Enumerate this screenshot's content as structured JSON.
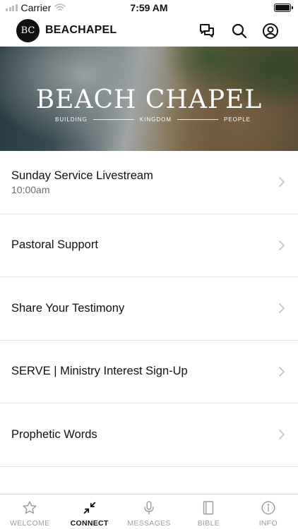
{
  "status_bar": {
    "carrier": "Carrier",
    "time": "7:59 AM"
  },
  "header": {
    "logo_text": "BC",
    "title": "BEACHAPEL"
  },
  "banner": {
    "title": "BEACH CHAPEL",
    "tagline": [
      "BUILDING",
      "KINGDOM",
      "PEOPLE"
    ]
  },
  "menu": [
    {
      "label": "Sunday Service Livestream",
      "sublabel": "10:00am"
    },
    {
      "label": "Pastoral Support"
    },
    {
      "label": "Share Your Testimony"
    },
    {
      "label": "SERVE | Ministry Interest Sign-Up"
    },
    {
      "label": "Prophetic Words"
    }
  ],
  "tabs": [
    {
      "label": "WELCOME",
      "icon": "star-icon"
    },
    {
      "label": "CONNECT",
      "icon": "arrows-in-icon",
      "active": true
    },
    {
      "label": "MESSAGES",
      "icon": "microphone-icon"
    },
    {
      "label": "BIBLE",
      "icon": "book-icon"
    },
    {
      "label": "INFO",
      "icon": "info-icon"
    }
  ],
  "colors": {
    "active_tab": "#111111",
    "inactive_tab": "#9e9e9e",
    "divider": "#e3e3e3"
  }
}
